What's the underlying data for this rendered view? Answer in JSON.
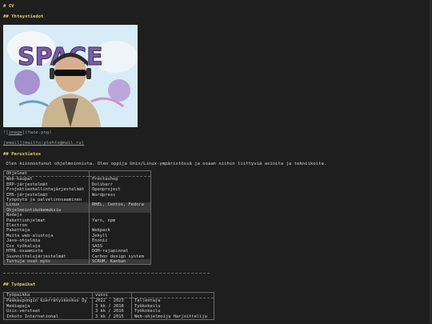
{
  "doc": {
    "title": "# CV",
    "contact_heading": "## Yhteystiedot",
    "image_caption_prefix": "![",
    "image_alt": "image",
    "image_caption_suffix": "](face.png)",
    "photo_text": "SPACE",
    "email_line": "[email](mailto:plehto@mail.ru)",
    "basics_heading": "## Perustietos",
    "intro": " Olen kiinnostunut ohjelmoinnista. Olen oppija Unix/Linux-ympäristössä ja osaan niihin liittyviä asioita ja tekniikoita.",
    "skills_header": [
      "Ohjelmat",
      ""
    ],
    "skills": [
      [
        "Web-kaupat",
        "Prestashop"
      ],
      [
        "ERP-järjestelmät",
        "Dolibarr"
      ],
      [
        "Projektienhallintajärjestelmät",
        "Openproject"
      ],
      [
        "CMS-järjestelmät",
        "Wordpress"
      ],
      [
        "Työpöytä ja palvelinosaaminen",
        ""
      ],
      [
        "Linux",
        "RHEL, Centos, Fedora"
      ],
      [
        "Ohjelmointikokemuksia",
        ""
      ],
      [
        "Nodejs",
        ""
      ],
      [
        "Pakettiohjelmat",
        "Yarn, npm"
      ],
      [
        "Electron",
        ""
      ],
      [
        "Paketteja",
        "Webpack"
      ],
      [
        "Muita web-alustoja",
        "Jekyll"
      ],
      [
        "Java-ohjelmia",
        "Enonic"
      ],
      [
        "Css työkaluja",
        "SASS"
      ],
      [
        "HTML-osaamista",
        "DOM-rajapinnat"
      ],
      [
        "Suunnittelujärjestelmät",
        "Carbon design system"
      ],
      [
        "Tuttuja ovat myös",
        "SCRUM, Kanban"
      ]
    ],
    "jobs_heading": "## Työpaikat",
    "jobs_header": [
      "Työpaikka",
      "vuosi",
      ""
    ],
    "jobs": [
      [
        "Pääkaupungin kierrätyskeskus Oy",
        "2022 - 2023",
        "Tallentaja"
      ],
      [
        "Mediapaja",
        "3 kk / 2018",
        "Työkokeilu"
      ],
      [
        "Usix-verstaat",
        "3 kk / 2016",
        "Työkokeilu"
      ],
      [
        "Inkoto International",
        "3 kk / 2015",
        "Web-ohjelmoija Harjoittelija"
      ]
    ]
  }
}
